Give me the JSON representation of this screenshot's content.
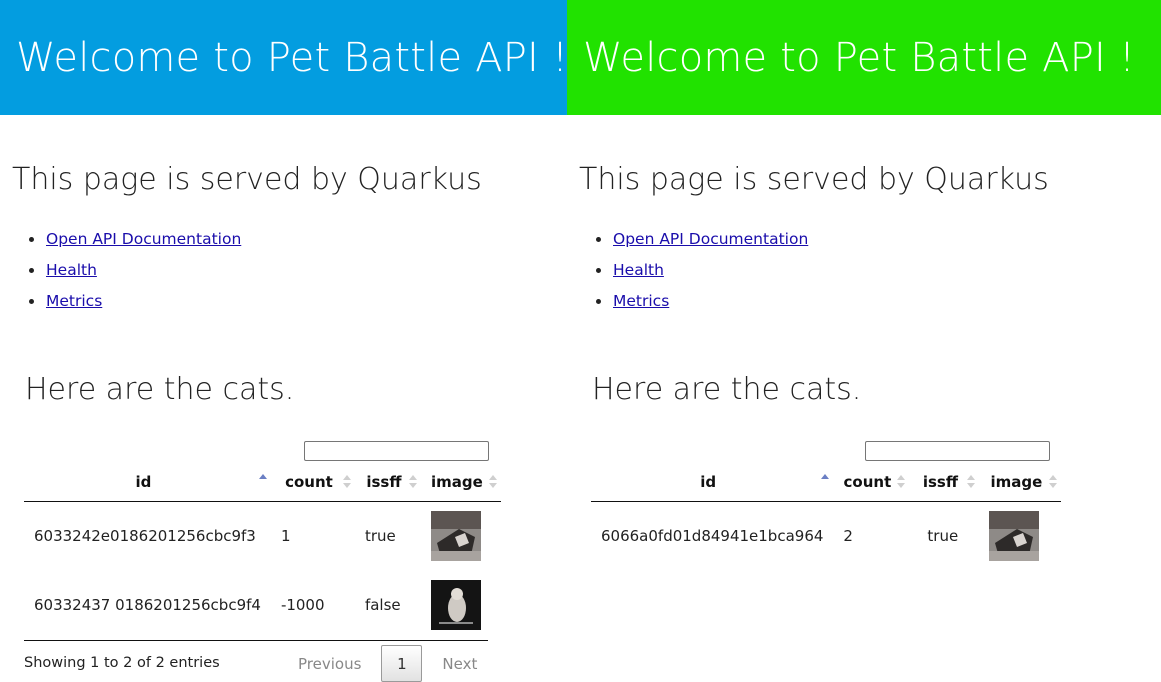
{
  "left": {
    "banner_title": "Welcome to Pet Battle API !",
    "banner_color": "#039de0",
    "subtitle": "This page is served by Quarkus",
    "links": [
      "Open API Documentation",
      "Health",
      "Metrics"
    ],
    "cats_title": "Here are the cats.",
    "search": {
      "value": ""
    },
    "columns": [
      "id",
      "count",
      "issff",
      "image"
    ],
    "sorted_column": "id",
    "rows": [
      {
        "id": "6033242e0186201256cbc9f3",
        "count": "1",
        "issff": "true",
        "image": "cat-photo-1"
      },
      {
        "id": "60332437 0186201256cbc9f4",
        "count": "-1000",
        "issff": "false",
        "image": "cat-photo-2"
      }
    ],
    "info": "Showing 1 to 2 of 2 entries",
    "pager": {
      "previous": "Previous",
      "page": "1",
      "next": "Next"
    }
  },
  "right": {
    "banner_title": "Welcome to Pet Battle API !",
    "banner_color": "#21e200",
    "subtitle": "This page is served by Quarkus",
    "links": [
      "Open API Documentation",
      "Health",
      "Metrics"
    ],
    "cats_title": "Here are the cats.",
    "search": {
      "value": ""
    },
    "columns": [
      "id",
      "count",
      "issff",
      "image"
    ],
    "sorted_column": "id",
    "rows": [
      {
        "id": "6066a0fd01d84941e1bca964",
        "count": "2",
        "issff": "true",
        "image": "cat-photo-1"
      }
    ]
  }
}
